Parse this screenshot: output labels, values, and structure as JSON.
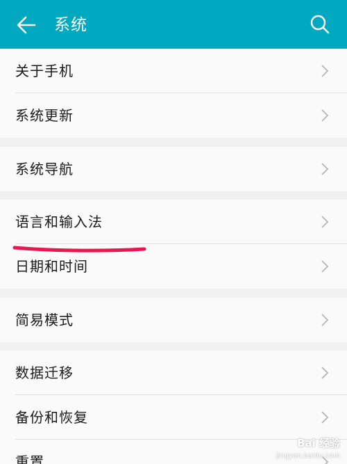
{
  "header": {
    "title": "系统",
    "back_icon": "arrow-left-icon",
    "search_icon": "search-icon",
    "color": "#00a9bf"
  },
  "groups": [
    {
      "items": [
        {
          "label": "关于手机"
        },
        {
          "label": "系统更新"
        }
      ]
    },
    {
      "items": [
        {
          "label": "系统导航"
        }
      ]
    },
    {
      "items": [
        {
          "label": "语言和输入法"
        },
        {
          "label": "日期和时间"
        }
      ]
    },
    {
      "items": [
        {
          "label": "简易模式"
        }
      ]
    },
    {
      "items": [
        {
          "label": "数据迁移"
        },
        {
          "label": "备份和恢复"
        },
        {
          "label": "重置"
        }
      ]
    }
  ],
  "annotation": {
    "color": "#e8174e"
  },
  "watermark": {
    "text": "Bai 经验",
    "sub": "jingyan.baidu.com"
  }
}
